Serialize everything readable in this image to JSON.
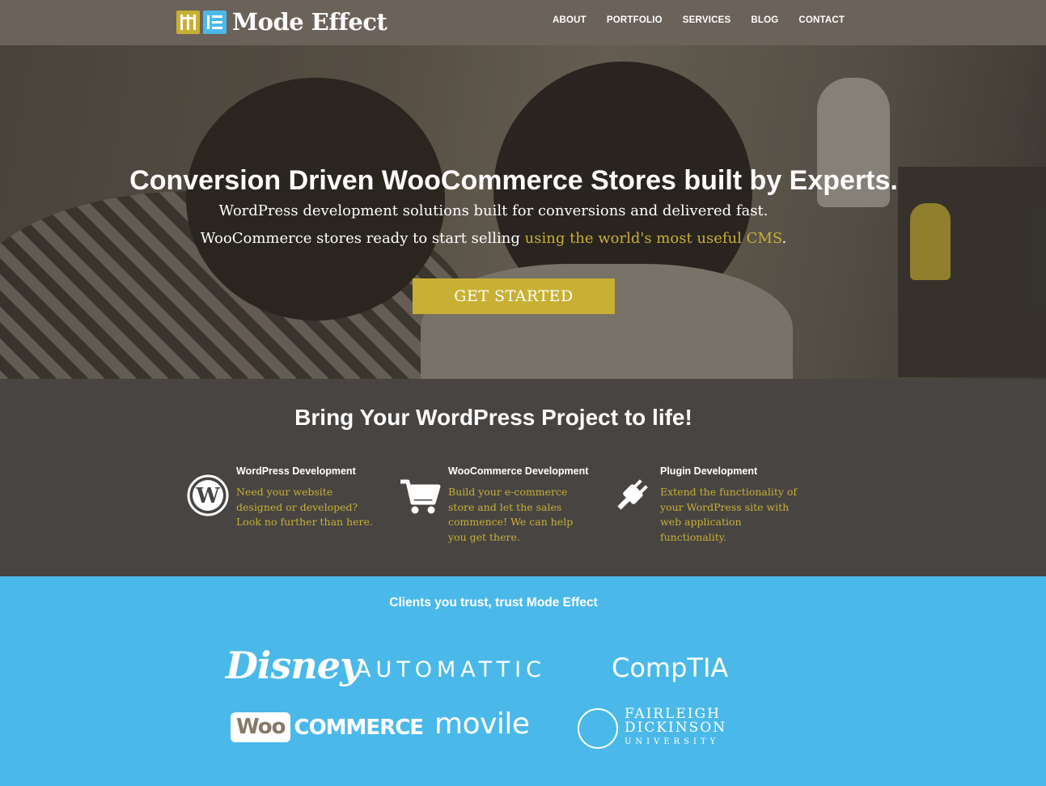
{
  "header": {
    "brand": "Mode Effect",
    "nav": [
      "ABOUT",
      "PORTFOLIO",
      "SERVICES",
      "BLOG",
      "CONTACT"
    ]
  },
  "hero": {
    "title": "Conversion Driven WooCommerce Stores built by Experts.",
    "subtitle_line1": "WordPress development solutions built for conversions and delivered fast.",
    "subtitle_line2_prefix": "WooCommerce stores ready to start selling ",
    "subtitle_line2_link": "using the world's most useful CMS",
    "subtitle_line2_suffix": ".",
    "cta_label": "GET STARTED"
  },
  "services": {
    "title": "Bring Your WordPress Project to life!",
    "items": [
      {
        "icon": "wordpress-icon",
        "title": "WordPress Development",
        "text": "Need your website designed or developed? Look no further than here."
      },
      {
        "icon": "cart-icon",
        "title": "WooCommerce Development",
        "text": "Build your e-commerce store and let the sales commence! We can help you get there."
      },
      {
        "icon": "plug-icon",
        "title": "Plugin Development",
        "text": "Extend the functionality of your WordPress site with web application functionality."
      }
    ]
  },
  "clients": {
    "title": "Clients you trust, trust Mode Effect",
    "logos": {
      "disney": "Disney",
      "automattic": "AUTOMATTIC",
      "comptia": "CompTIA",
      "woo_box": "Woo",
      "woo_word": "COMMERCE",
      "movile": "movile",
      "fdu_line1": "FAIRLEIGH",
      "fdu_line2": "DICKINSON",
      "fdu_line3": "UNIVERSITY"
    }
  },
  "colors": {
    "header_bg": "#6b6259",
    "accent_gold": "#c8b034",
    "accent_blue": "#4ab9ea",
    "services_bg": "#474442"
  }
}
